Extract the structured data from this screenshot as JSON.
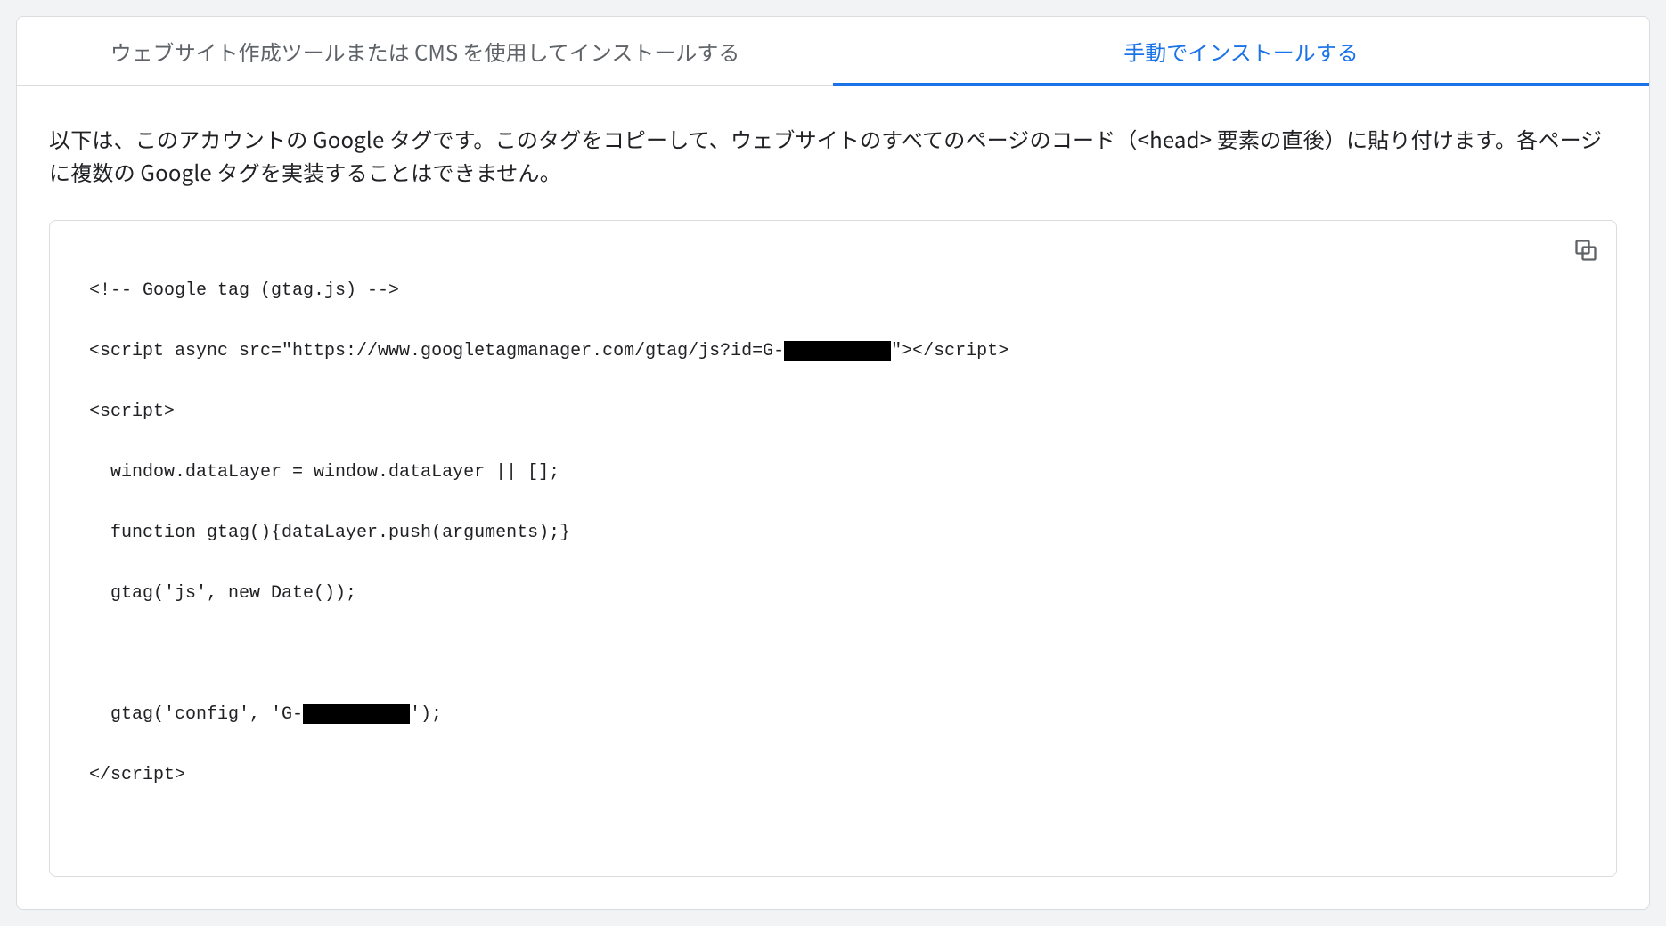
{
  "tabs": {
    "builder": {
      "label": "ウェブサイト作成ツールまたは CMS を使用してインストールする"
    },
    "manual": {
      "label": "手動でインストールする",
      "active": true
    }
  },
  "description": "以下は、このアカウントの Google タグです。このタグをコピーして、ウェブサイトのすべてのページのコード（<head> 要素の直後）に貼り付けます。各ページに複数の Google タグを実装することはできません。",
  "code": {
    "line1": "<!-- Google tag (gtag.js) -->",
    "line2_a": "<script async src=\"https://www.googletagmanager.com/gtag/js?id=G-",
    "line2_redacted": "██████████",
    "line2_b": "\"></script>",
    "line3": "<script>",
    "line4": "  window.dataLayer = window.dataLayer || [];",
    "line5": "  function gtag(){dataLayer.push(arguments);}",
    "line6": "  gtag('js', new Date());",
    "line7": "",
    "line8_a": "  gtag('config', 'G-",
    "line8_redacted": "██████████",
    "line8_b": "');",
    "line9": "</script>"
  },
  "actions": {
    "copy": "copy"
  }
}
